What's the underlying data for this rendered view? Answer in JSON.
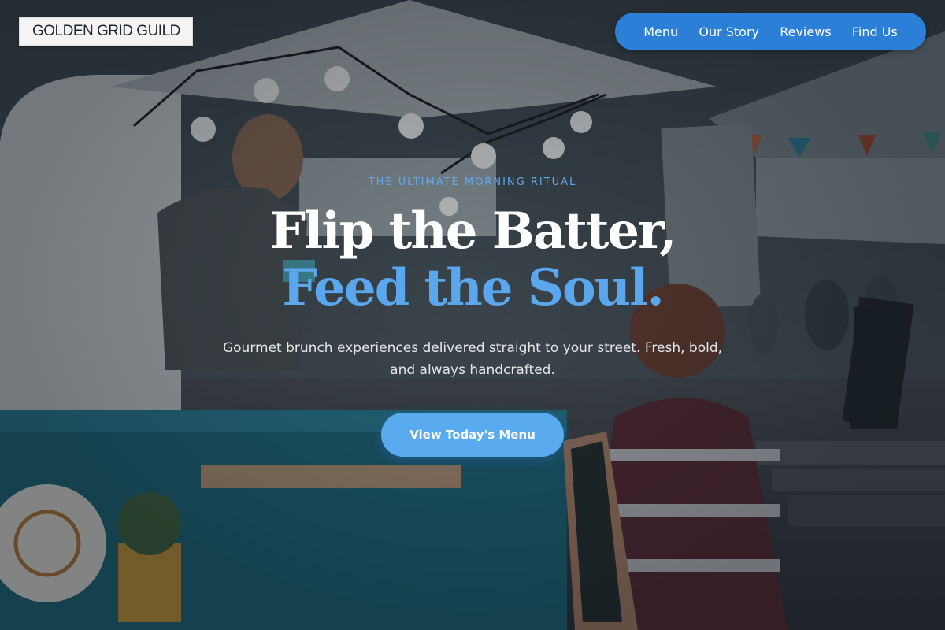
{
  "brand": {
    "name": "GOLDEN GRID GUILD"
  },
  "nav": {
    "items": [
      {
        "label": "Menu"
      },
      {
        "label": "Our Story"
      },
      {
        "label": "Reviews"
      },
      {
        "label": "Find Us"
      }
    ],
    "background_color": "#2b7fd6"
  },
  "hero": {
    "kicker": "THE ULTIMATE MORNING RITUAL",
    "headline_line1": "Flip the Batter,",
    "headline_line2": "Feed the Soul.",
    "subtitle": "Gourmet brunch experiences delivered straight to your street. Fresh, bold, and always handcrafted.",
    "cta_label": "View Today's Menu",
    "accent_color": "#5aa7ee"
  }
}
